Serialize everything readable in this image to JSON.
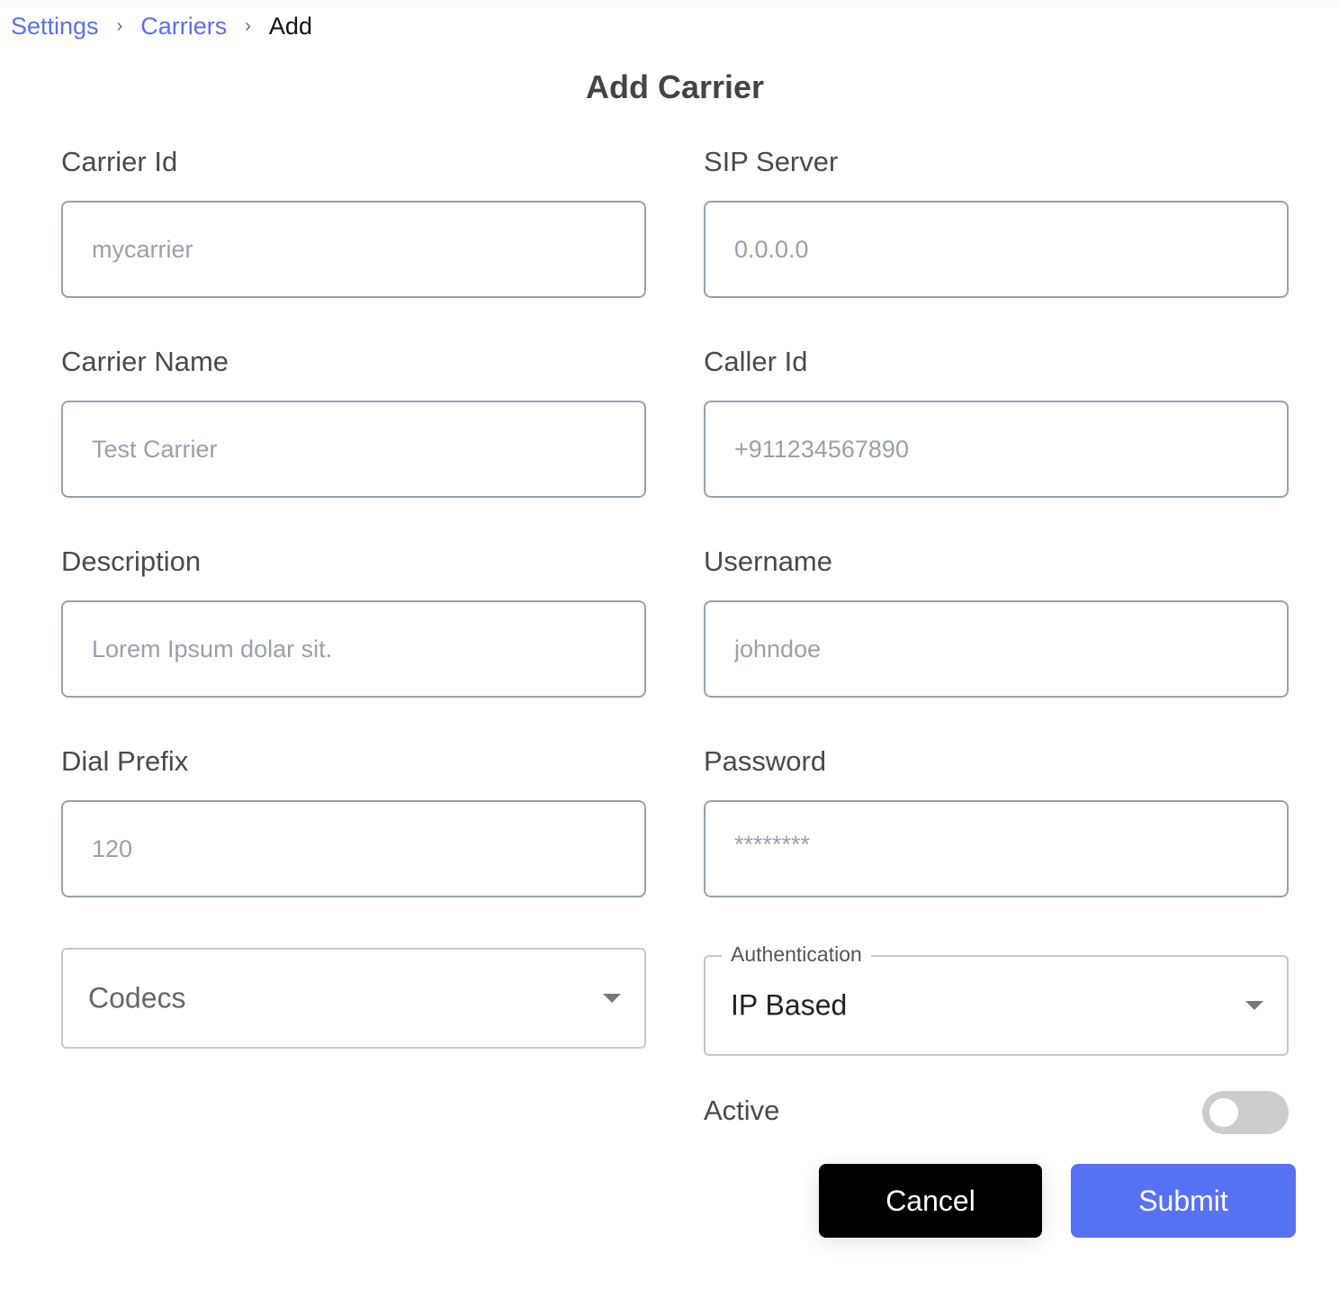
{
  "breadcrumb": {
    "items": [
      {
        "label": "Settings"
      },
      {
        "label": "Carriers"
      }
    ],
    "separator": "›",
    "current": "Add"
  },
  "page": {
    "title": "Add Carrier"
  },
  "form": {
    "carrier_id": {
      "label": "Carrier Id",
      "value": "",
      "placeholder": "mycarrier"
    },
    "carrier_name": {
      "label": "Carrier Name",
      "value": "",
      "placeholder": "Test Carrier"
    },
    "description": {
      "label": "Description",
      "value": "",
      "placeholder": "Lorem Ipsum dolar sit."
    },
    "dial_prefix": {
      "label": "Dial Prefix",
      "value": "",
      "placeholder": "120"
    },
    "sip_server": {
      "label": "SIP Server",
      "value": "",
      "placeholder": "0.0.0.0"
    },
    "caller_id": {
      "label": "Caller Id",
      "value": "",
      "placeholder": "+911234567890"
    },
    "username": {
      "label": "Username",
      "value": "",
      "placeholder": "johndoe"
    },
    "password": {
      "label": "Password",
      "value": "",
      "placeholder": "********"
    },
    "codecs": {
      "placeholder": "Codecs"
    },
    "authentication": {
      "label": "Authentication",
      "value": "IP Based"
    },
    "active": {
      "label": "Active",
      "checked": false
    }
  },
  "actions": {
    "cancel_label": "Cancel",
    "submit_label": "Submit"
  },
  "colors": {
    "accent": "#5671f4",
    "link": "#5a6ff0",
    "toggle_off": "#cccccc"
  }
}
